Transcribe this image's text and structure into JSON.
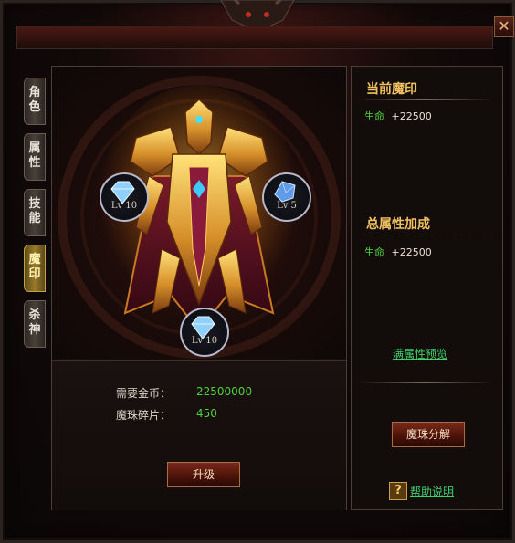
{
  "window": {
    "close_label": "✕"
  },
  "tabs": [
    {
      "label": "角色",
      "active": false
    },
    {
      "label": "属性",
      "active": false
    },
    {
      "label": "技能",
      "active": false
    },
    {
      "label": "魔印",
      "active": true
    },
    {
      "label": "杀神",
      "active": false
    }
  ],
  "gems": [
    {
      "level": "Lv 10",
      "color": "#8fd0ff"
    },
    {
      "level": "Lv 5",
      "color": "#5f9be8"
    },
    {
      "level": "Lv 10",
      "color": "#8fd0ff"
    }
  ],
  "cost": {
    "gold_label": "需要金币：",
    "gold_value": "22500000",
    "fragment_label": "魔珠碎片：",
    "fragment_value": "450"
  },
  "upgrade_button": "升级",
  "current_seal": {
    "title": "当前魔印",
    "attr_name": "生命",
    "attr_value": "+22500"
  },
  "total_bonus": {
    "title": "总属性加成",
    "attr_name": "生命",
    "attr_value": "+22500"
  },
  "preview_link": "满属性预览",
  "decompose_button": "魔珠分解",
  "help": {
    "icon": "?",
    "link": "帮助说明"
  },
  "colors": {
    "accent_gold": "#f0c060",
    "positive_green": "#4fd13a"
  }
}
